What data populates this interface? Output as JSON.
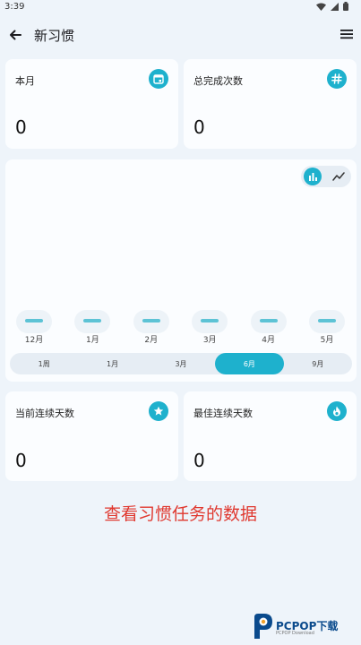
{
  "status": {
    "time": "3:39"
  },
  "app_bar": {
    "title": "新习惯"
  },
  "stats_top": [
    {
      "label": "本月",
      "value": "0",
      "icon": "calendar-icon"
    },
    {
      "label": "总完成次数",
      "value": "0",
      "icon": "hash-icon"
    }
  ],
  "chart": {
    "view_toggle": [
      "bar-chart-icon",
      "line-chart-icon"
    ],
    "months": [
      "12月",
      "1月",
      "2月",
      "3月",
      "4月",
      "5月"
    ]
  },
  "chart_data": {
    "type": "bar",
    "categories": [
      "12月",
      "1月",
      "2月",
      "3月",
      "4月",
      "5月"
    ],
    "values": [
      0,
      0,
      0,
      0,
      0,
      0
    ]
  },
  "ranges": [
    {
      "label": "1周",
      "active": false
    },
    {
      "label": "1月",
      "active": false
    },
    {
      "label": "3月",
      "active": false
    },
    {
      "label": "6月",
      "active": true
    },
    {
      "label": "9月",
      "active": false
    }
  ],
  "stats_bottom": [
    {
      "label": "当前连续天数",
      "value": "0",
      "icon": "star-icon"
    },
    {
      "label": "最佳连续天数",
      "value": "0",
      "icon": "flame-icon"
    }
  ],
  "caption": "查看习惯任务的数据",
  "watermark": {
    "brand": "PCPOP下载",
    "sub": "PCPOP Download"
  },
  "colors": {
    "accent": "#1eb1cd",
    "caption": "#e0382f",
    "background": "#eef4fa"
  }
}
